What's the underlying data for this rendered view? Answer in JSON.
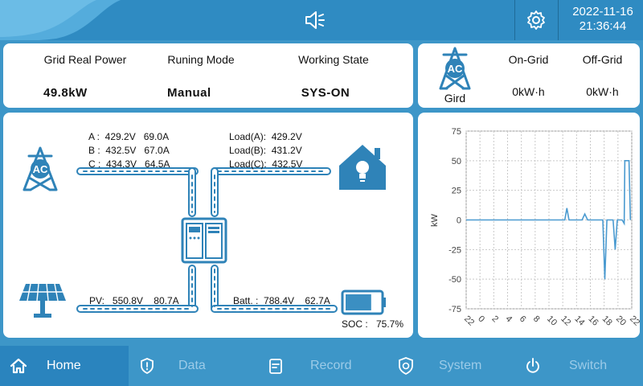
{
  "header": {
    "date": "2022-11-16",
    "time": "21:36:44",
    "icons": {
      "sound": "speaker-icon",
      "settings": "gear-icon"
    }
  },
  "summary": {
    "grid_power_label": "Grid Real Power",
    "grid_power_value": "49.8kW",
    "mode_label": "Runing Mode",
    "mode_value": "Manual",
    "state_label": "Working State",
    "state_value": "SYS-ON"
  },
  "grid_box": {
    "icon_text": "AC",
    "caption": "Gird",
    "on_grid_label": "On-Grid",
    "on_grid_value": "0kW·h",
    "off_grid_label": "Off-Grid",
    "off_grid_value": "0kW·h"
  },
  "flow": {
    "grid_icon_text": "AC",
    "phase_a": "A :  429.2V   69.0A",
    "phase_b": "B :  432.5V   67.0A",
    "phase_c": "C :  434.3V   64.5A",
    "load_a": "Load(A):  429.2V",
    "load_b": "Load(B):  431.2V",
    "load_c": "Load(C):  432.5V",
    "pv": "PV:   550.8V    80.7A",
    "batt": "Batt. :  788.4V    62.7A",
    "soc_label": "SOC :",
    "soc_value": "75.7%",
    "battery_level": 0.757,
    "colors": {
      "accent": "#3b8fc2",
      "dark": "#1f6f9f",
      "line": "#2f83b8"
    }
  },
  "chart_data": {
    "type": "line",
    "ylabel": "kW",
    "ylim": [
      -75,
      75
    ],
    "yticks": [
      75,
      50,
      25,
      0,
      -25,
      -50,
      -75
    ],
    "xlim": [
      -2,
      22
    ],
    "xticks": [
      -2,
      0,
      2,
      4,
      6,
      8,
      10,
      12,
      14,
      16,
      18,
      20,
      22
    ],
    "xtick_labels": [
      "22",
      "0",
      "2",
      "4",
      "6",
      "8",
      "10",
      "12",
      "14",
      "16",
      "18",
      "20",
      "22"
    ],
    "grid": true,
    "color": "#4a9ad0",
    "series": [
      {
        "x": [
          -2,
          12.3,
          12.6,
          12.9,
          14.8,
          15.2,
          15.6,
          17.8,
          18.1,
          18.4,
          19.3,
          19.6,
          19.9,
          20.6,
          20.9,
          21.0,
          21.6,
          21.8
        ],
        "y": [
          0,
          0,
          10,
          0,
          0,
          5,
          0,
          0,
          -50,
          0,
          0,
          -25,
          0,
          0,
          -3,
          50,
          50,
          0
        ]
      }
    ]
  },
  "nav": {
    "items": [
      {
        "label": "Home",
        "icon": "home-icon",
        "active": true
      },
      {
        "label": "Data",
        "icon": "shield-icon",
        "active": false
      },
      {
        "label": "Record",
        "icon": "document-icon",
        "active": false
      },
      {
        "label": "System",
        "icon": "settings-shield-icon",
        "active": false
      },
      {
        "label": "Switch",
        "icon": "power-icon",
        "active": false
      }
    ]
  }
}
